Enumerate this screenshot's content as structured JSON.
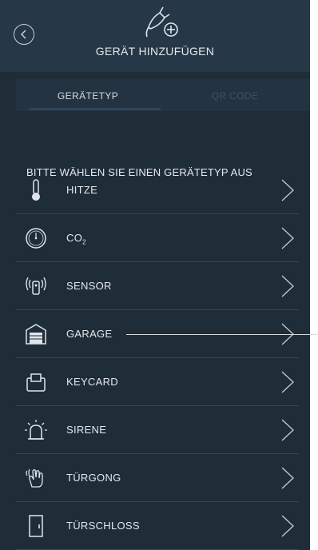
{
  "header": {
    "title": "GERÄT HINZUFÜGEN",
    "back_icon": "back-arrow-icon",
    "device_icon": "plug-add-icon"
  },
  "tabs": [
    {
      "label": "GERÄTETYP",
      "active": true
    },
    {
      "label": "QR CODE",
      "active": false
    }
  ],
  "prompt": "BITTE WÄHLEN SIE EINEN GERÄTETYP AUS",
  "items": [
    {
      "label": "HITZE",
      "icon": "thermometer-icon"
    },
    {
      "label": "CO",
      "sub": "2",
      "icon": "co2-gauge-icon"
    },
    {
      "label": "SENSOR",
      "icon": "sensor-icon"
    },
    {
      "label": "GARAGE",
      "icon": "garage-icon"
    },
    {
      "label": "KEYCARD",
      "icon": "keycard-icon"
    },
    {
      "label": "SIRENE",
      "icon": "siren-icon"
    },
    {
      "label": "TÜRGONG",
      "icon": "doorbell-icon"
    },
    {
      "label": "TÜRSCHLOSS",
      "icon": "door-lock-icon"
    }
  ],
  "colors": {
    "background": "#1f2d39",
    "header": "#263747",
    "text": "#e3e8ec",
    "inactive_tab": "#3c5263",
    "divider": "#33475a"
  }
}
